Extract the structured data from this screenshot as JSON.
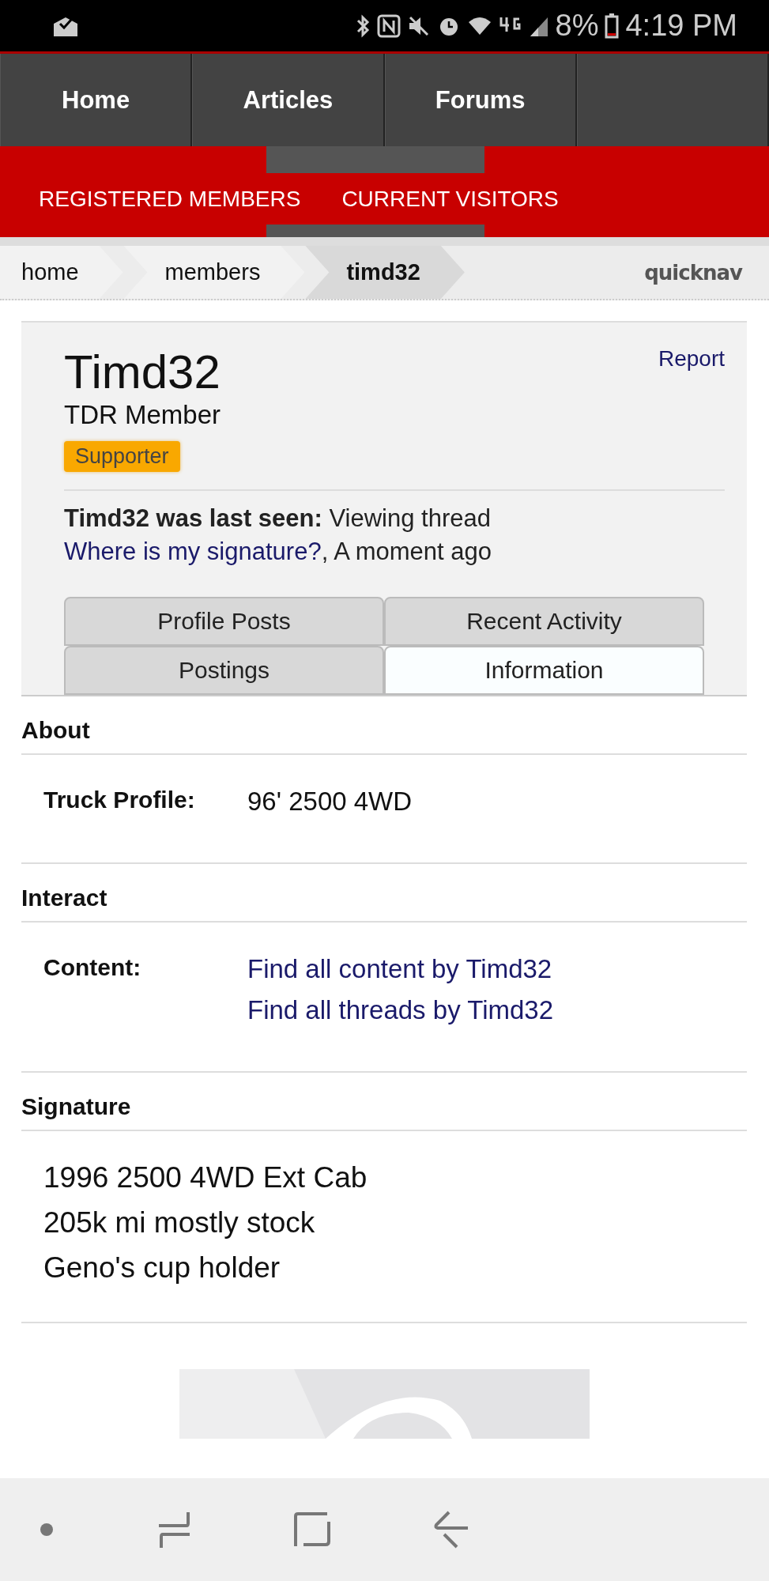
{
  "status_bar": {
    "battery": "8%",
    "time": "4:19 PM"
  },
  "nav": {
    "items": [
      {
        "label": "Home"
      },
      {
        "label": "Articles"
      },
      {
        "label": "Forums"
      }
    ]
  },
  "subnav": {
    "items": [
      {
        "label": "REGISTERED MEMBERS"
      },
      {
        "label": "CURRENT VISITORS"
      }
    ]
  },
  "breadcrumb": {
    "items": [
      {
        "label": "home",
        "selected": false
      },
      {
        "label": "members",
        "selected": false
      },
      {
        "label": "timd32",
        "selected": true
      }
    ],
    "quicknav": "quicknav"
  },
  "profile": {
    "name": "Timd32",
    "title": "TDR Member",
    "badge": "Supporter",
    "report": "Report",
    "last_seen": {
      "label": "Timd32 was last seen:",
      "text": "Viewing thread",
      "link": "Where is my signature?",
      "suffix": ", A moment ago"
    }
  },
  "tabs": [
    [
      {
        "label": "Profile Posts",
        "selected": false
      },
      {
        "label": "Recent Activity",
        "selected": false
      }
    ],
    [
      {
        "label": "Postings",
        "selected": false
      },
      {
        "label": "Information",
        "selected": true
      }
    ]
  ],
  "sections": [
    {
      "title": "About",
      "rows": [
        {
          "label": "Truck Profile:",
          "kind": "text",
          "values": [
            "96' 2500 4WD"
          ]
        }
      ]
    },
    {
      "title": "Interact",
      "rows": [
        {
          "label": "Content:",
          "kind": "links",
          "values": [
            "Find all content by Timd32",
            "Find all threads by Timd32"
          ]
        }
      ]
    }
  ],
  "signature": {
    "title": "Signature",
    "lines": [
      "1996 2500 4WD Ext Cab",
      "205k mi mostly stock",
      "Geno's cup holder"
    ]
  }
}
